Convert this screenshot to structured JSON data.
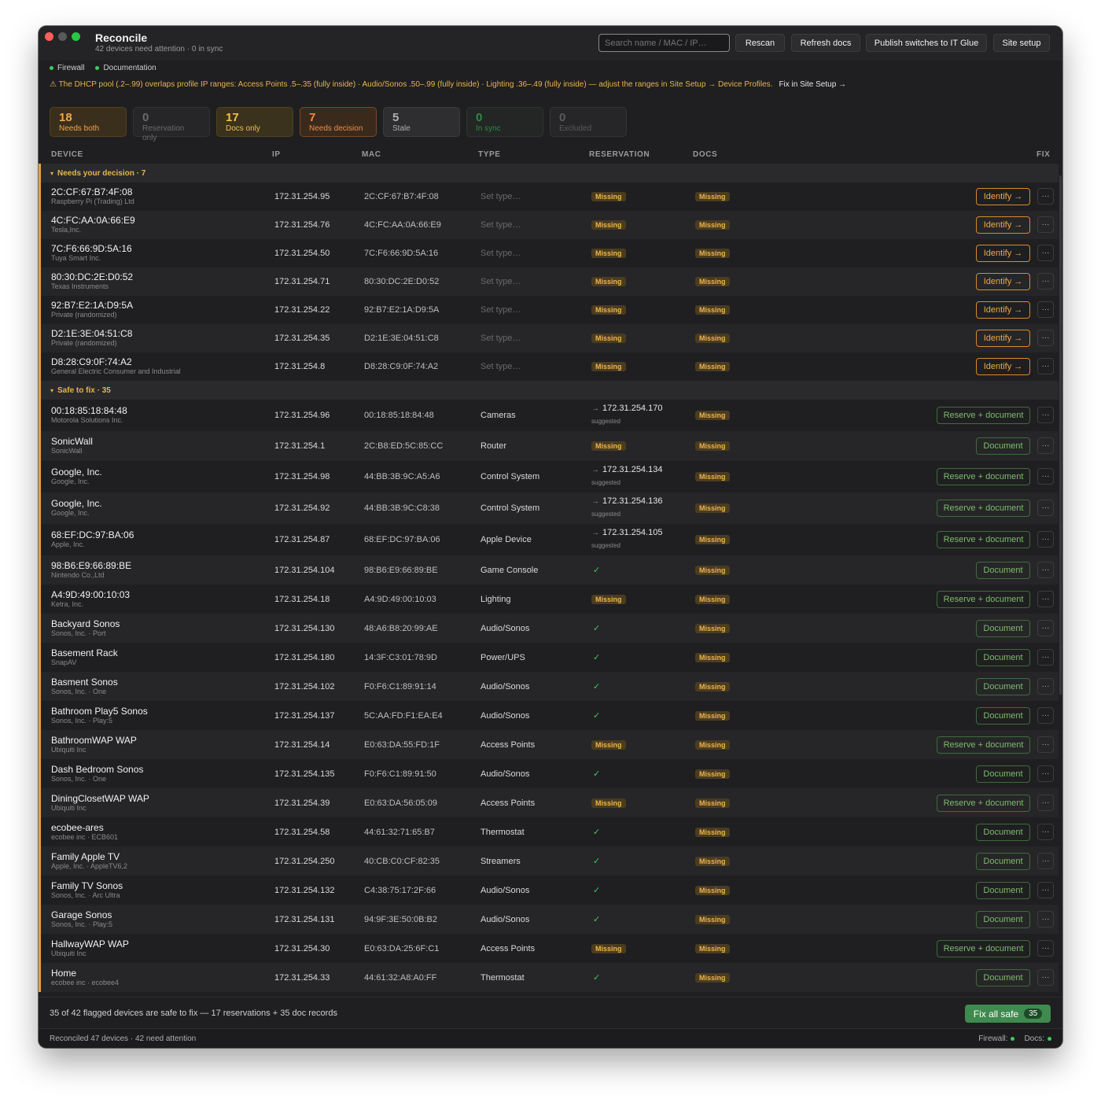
{
  "window": {
    "title": "Reconcile",
    "subtitle": "42 devices need attention · 0 in sync"
  },
  "toolbar": {
    "search_placeholder": "Search name / MAC / IP…",
    "rescan": "Rescan",
    "refresh_docs": "Refresh docs",
    "publish": "Publish switches to IT Glue",
    "site_setup": "Site setup"
  },
  "status": {
    "firewall": "Firewall",
    "documentation": "Documentation"
  },
  "warning": {
    "text": "⚠ The DHCP pool (.2–.99) overlaps profile IP ranges: Access Points .5–.35 (fully inside) · Audio/Sonos .50–.99 (fully inside) · Lighting .36–.49 (fully inside) — adjust the ranges in Site Setup → Device Profiles.",
    "fix_link": "Fix in Site Setup →",
    "color": "#e8b44a"
  },
  "stats": [
    {
      "num": "18",
      "label": "Needs both",
      "color": "#f0a848",
      "bg": "#3a2e1c",
      "border": "#54401f"
    },
    {
      "num": "0",
      "label": "Reservation only",
      "color": "#6a6a6e",
      "bg": "#262628",
      "border": "#333336"
    },
    {
      "num": "17",
      "label": "Docs only",
      "color": "#f0c048",
      "bg": "#3a321c",
      "border": "#4e421f"
    },
    {
      "num": "7",
      "label": "Needs decision",
      "color": "#f08c48",
      "bg": "#3a2a1c",
      "border": "#7a4a24"
    },
    {
      "num": "5",
      "label": "Stale",
      "color": "#aeaeb2",
      "bg": "#2e2e31",
      "border": "#3c3c40"
    },
    {
      "num": "0",
      "label": "In sync",
      "color": "#2f8a46",
      "bg": "#232625",
      "border": "#2e3330"
    },
    {
      "num": "0",
      "label": "Excluded",
      "color": "#5a5a5e",
      "bg": "#262628",
      "border": "#333336"
    }
  ],
  "columns": {
    "device": "DEVICE",
    "ip": "IP",
    "mac": "MAC",
    "type": "TYPE",
    "reservation": "RESERVATION",
    "docs": "DOCS",
    "fix": "FIX"
  },
  "labels": {
    "missing": "Missing",
    "suggested": "suggested",
    "more": "···",
    "arrow": "→"
  },
  "groups": {
    "decision": "Needs your decision · 7",
    "safe": "Safe to fix · 35"
  },
  "decision_rows": [
    {
      "name": "2C:CF:67:B7:4F:08",
      "vendor": "Raspberry Pi (Trading) Ltd",
      "ip": "172.31.254.95",
      "mac": "2C:CF:67:B7:4F:08",
      "type": "Set type…",
      "fix": "Identify →"
    },
    {
      "name": "4C:FC:AA:0A:66:E9",
      "vendor": "Tesla,Inc.",
      "ip": "172.31.254.76",
      "mac": "4C:FC:AA:0A:66:E9",
      "type": "Set type…",
      "fix": "Identify →"
    },
    {
      "name": "7C:F6:66:9D:5A:16",
      "vendor": "Tuya Smart Inc.",
      "ip": "172.31.254.50",
      "mac": "7C:F6:66:9D:5A:16",
      "type": "Set type…",
      "fix": "Identify →"
    },
    {
      "name": "80:30:DC:2E:D0:52",
      "vendor": "Texas Instruments",
      "ip": "172.31.254.71",
      "mac": "80:30:DC:2E:D0:52",
      "type": "Set type…",
      "fix": "Identify →"
    },
    {
      "name": "92:B7:E2:1A:D9:5A",
      "vendor": "Private (randomized)",
      "ip": "172.31.254.22",
      "mac": "92:B7:E2:1A:D9:5A",
      "type": "Set type…",
      "fix": "Identify →"
    },
    {
      "name": "D2:1E:3E:04:51:C8",
      "vendor": "Private (randomized)",
      "ip": "172.31.254.35",
      "mac": "D2:1E:3E:04:51:C8",
      "type": "Set type…",
      "fix": "Identify →"
    },
    {
      "name": "D8:28:C9:0F:74:A2",
      "vendor": "General Electric Consumer and Industrial",
      "ip": "172.31.254.8",
      "mac": "D8:28:C9:0F:74:A2",
      "type": "Set type…",
      "fix": "Identify →"
    }
  ],
  "safe_rows": [
    {
      "name": "00:18:85:18:84:48",
      "vendor": "Motorola Solutions Inc.",
      "ip": "172.31.254.96",
      "mac": "00:18:85:18:84:48",
      "type": "Cameras",
      "res": "suggest",
      "res_ip": "172.31.254.170",
      "fix": "Reserve + document"
    },
    {
      "name": "SonicWall",
      "vendor": "SonicWall",
      "ip": "172.31.254.1",
      "mac": "2C:B8:ED:5C:85:CC",
      "type": "Router",
      "res": "missing",
      "fix": "Document"
    },
    {
      "name": "Google, Inc.",
      "vendor": "Google, Inc.",
      "ip": "172.31.254.98",
      "mac": "44:BB:3B:9C:A5:A6",
      "type": "Control System",
      "res": "suggest",
      "res_ip": "172.31.254.134",
      "fix": "Reserve + document"
    },
    {
      "name": "Google, Inc.",
      "vendor": "Google, Inc.",
      "ip": "172.31.254.92",
      "mac": "44:BB:3B:9C:C8:38",
      "type": "Control System",
      "res": "suggest",
      "res_ip": "172.31.254.136",
      "fix": "Reserve + document"
    },
    {
      "name": "68:EF:DC:97:BA:06",
      "vendor": "Apple, Inc.",
      "ip": "172.31.254.87",
      "mac": "68:EF:DC:97:BA:06",
      "type": "Apple Device",
      "res": "suggest",
      "res_ip": "172.31.254.105",
      "fix": "Reserve + document"
    },
    {
      "name": "98:B6:E9:66:89:BE",
      "vendor": "Nintendo Co.,Ltd",
      "ip": "172.31.254.104",
      "mac": "98:B6:E9:66:89:BE",
      "type": "Game Console",
      "res": "ok",
      "fix": "Document"
    },
    {
      "name": "A4:9D:49:00:10:03",
      "vendor": "Ketra, Inc.",
      "ip": "172.31.254.18",
      "mac": "A4:9D:49:00:10:03",
      "type": "Lighting",
      "res": "missing",
      "fix": "Reserve + document"
    },
    {
      "name": "Backyard Sonos",
      "vendor": "Sonos, Inc. · Port",
      "ip": "172.31.254.130",
      "mac": "48:A6:B8:20:99:AE",
      "type": "Audio/Sonos",
      "res": "ok",
      "fix": "Document"
    },
    {
      "name": "Basement Rack",
      "vendor": "SnapAV",
      "ip": "172.31.254.180",
      "mac": "14:3F:C3:01:78:9D",
      "type": "Power/UPS",
      "res": "ok",
      "fix": "Document"
    },
    {
      "name": "Basment Sonos",
      "vendor": "Sonos, Inc. · One",
      "ip": "172.31.254.102",
      "mac": "F0:F6:C1:89:91:14",
      "type": "Audio/Sonos",
      "res": "ok",
      "fix": "Document"
    },
    {
      "name": "Bathroom Play5 Sonos",
      "vendor": "Sonos, Inc. · Play:5",
      "ip": "172.31.254.137",
      "mac": "5C:AA:FD:F1:EA:E4",
      "type": "Audio/Sonos",
      "res": "ok",
      "fix": "Document"
    },
    {
      "name": "BathroomWAP WAP",
      "vendor": "Ubiquiti Inc",
      "ip": "172.31.254.14",
      "mac": "E0:63:DA:55:FD:1F",
      "type": "Access Points",
      "res": "missing",
      "fix": "Reserve + document"
    },
    {
      "name": "Dash Bedroom Sonos",
      "vendor": "Sonos, Inc. · One",
      "ip": "172.31.254.135",
      "mac": "F0:F6:C1:89:91:50",
      "type": "Audio/Sonos",
      "res": "ok",
      "fix": "Document"
    },
    {
      "name": "DiningClosetWAP WAP",
      "vendor": "Ubiquiti Inc",
      "ip": "172.31.254.39",
      "mac": "E0:63:DA:56:05:09",
      "type": "Access Points",
      "res": "missing",
      "fix": "Reserve + document"
    },
    {
      "name": "ecobee-ares",
      "vendor": "ecobee inc · ECB601",
      "ip": "172.31.254.58",
      "mac": "44:61:32:71:65:B7",
      "type": "Thermostat",
      "res": "ok",
      "fix": "Document"
    },
    {
      "name": "Family Apple TV",
      "vendor": "Apple, Inc. · AppleTV6,2",
      "ip": "172.31.254.250",
      "mac": "40:CB:C0:CF:82:35",
      "type": "Streamers",
      "res": "ok",
      "fix": "Document"
    },
    {
      "name": "Family TV Sonos",
      "vendor": "Sonos, Inc. · Arc Ultra",
      "ip": "172.31.254.132",
      "mac": "C4:38:75:17:2F:66",
      "type": "Audio/Sonos",
      "res": "ok",
      "fix": "Document"
    },
    {
      "name": "Garage Sonos",
      "vendor": "Sonos, Inc. · Play:5",
      "ip": "172.31.254.131",
      "mac": "94:9F:3E:50:0B:B2",
      "type": "Audio/Sonos",
      "res": "ok",
      "fix": "Document"
    },
    {
      "name": "HallwayWAP WAP",
      "vendor": "Ubiquiti Inc",
      "ip": "172.31.254.30",
      "mac": "E0:63:DA:25:6F:C1",
      "type": "Access Points",
      "res": "missing",
      "fix": "Reserve + document"
    },
    {
      "name": "Home",
      "vendor": "ecobee inc · ecobee4",
      "ip": "172.31.254.33",
      "mac": "44:61:32:A8:A0:FF",
      "type": "Thermostat",
      "res": "ok",
      "fix": "Document"
    }
  ],
  "footer": {
    "summary": "35 of 42 flagged devices are safe to fix — 17 reservations + 35 doc records",
    "fix_all": "Fix all safe",
    "fix_all_count": "35"
  },
  "statusbar": {
    "left": "Reconciled 47 devices · 42 need attention",
    "firewall": "Firewall:",
    "docs": "Docs:"
  }
}
